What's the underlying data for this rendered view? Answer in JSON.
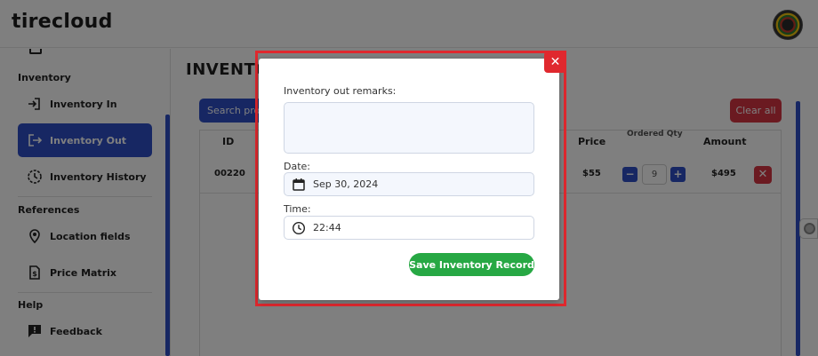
{
  "app": {
    "logo_text": "tirecloud"
  },
  "sidebar": {
    "sections": [
      {
        "title": "Inventory",
        "items": [
          {
            "label": "Inventory In",
            "icon": "login-arrow-icon",
            "active": false
          },
          {
            "label": "Inventory Out",
            "icon": "logout-arrow-icon",
            "active": true
          },
          {
            "label": "Inventory History",
            "icon": "history-clock-icon",
            "active": false
          }
        ]
      },
      {
        "title": "References",
        "items": [
          {
            "label": "Location fields",
            "icon": "location-pin-icon",
            "active": false
          },
          {
            "label": "Price Matrix",
            "icon": "dollar-document-icon",
            "active": false
          }
        ]
      },
      {
        "title": "Help",
        "items": [
          {
            "label": "Feedback",
            "icon": "feedback-icon",
            "active": false
          }
        ]
      }
    ]
  },
  "main": {
    "title": "INVENTOR",
    "search_button_label": "Search prod",
    "clear_button_label": "Clear all",
    "table": {
      "headers": {
        "id": "ID",
        "price": "Price",
        "quantity": "Ordered Qty",
        "amount": "Amount"
      },
      "rows": [
        {
          "id": "00220",
          "price": "$55",
          "quantity": "9",
          "amount": "$495",
          "minus": "−",
          "plus": "+",
          "delete": "✕"
        }
      ]
    }
  },
  "modal": {
    "close_label": "✕",
    "remarks_label": "Inventory out remarks:",
    "remarks_value": "",
    "date_label": "Date:",
    "date_value": "Sep 30, 2024",
    "time_label": "Time:",
    "time_value": "22:44",
    "save_label": "Save Inventory Record"
  },
  "colors": {
    "accent": "#2f4fc6",
    "danger": "#d63442",
    "success": "#27a844",
    "highlight_outline": "#e0282e"
  }
}
